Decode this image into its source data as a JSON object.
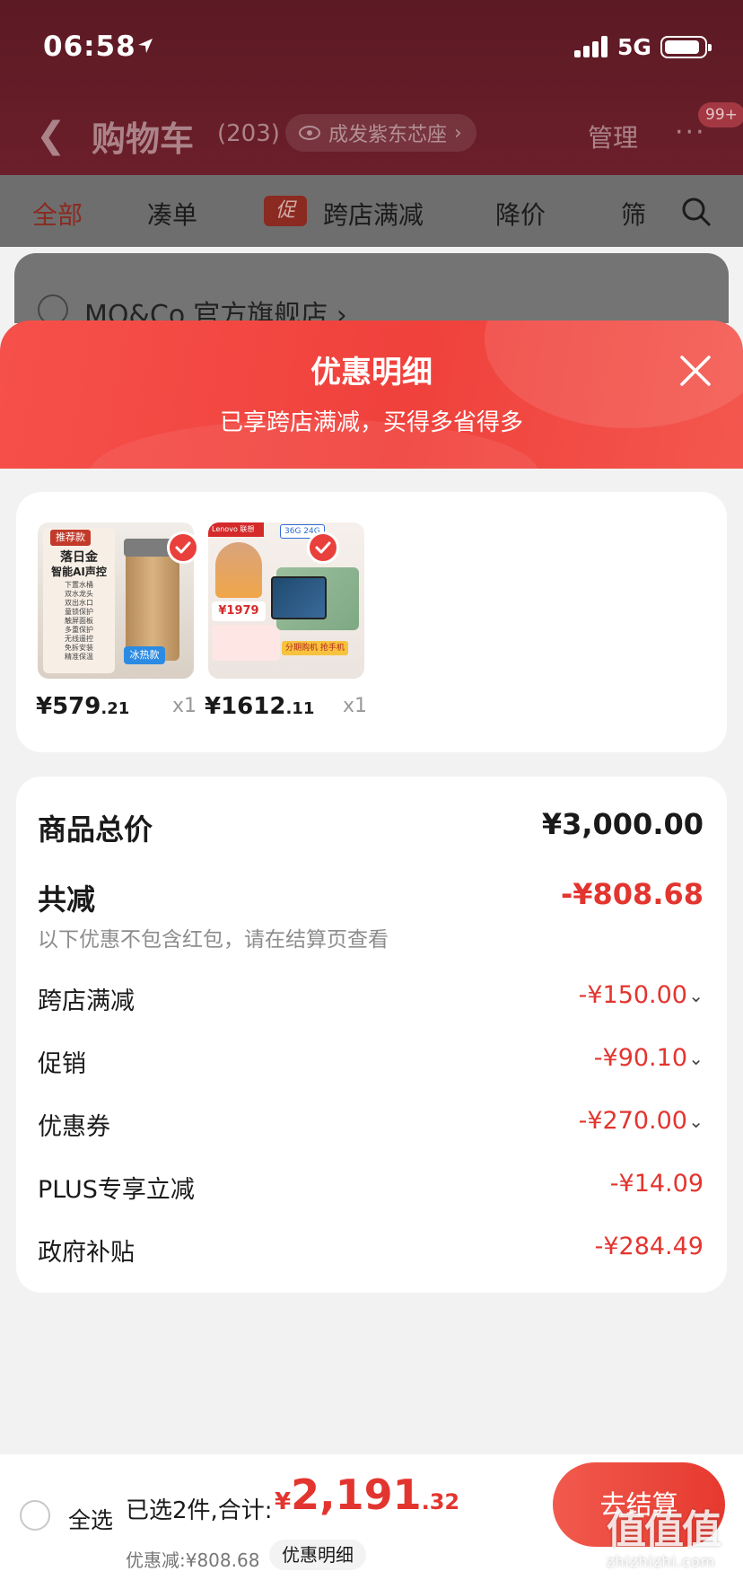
{
  "status_bar": {
    "time": "06:58",
    "network": "5G"
  },
  "nav": {
    "title": "购物车",
    "count": "(203)",
    "address": "成发紫东芯座",
    "manage": "管理",
    "more": "···",
    "badge": "99+"
  },
  "tabs": {
    "all": "全部",
    "bundle": "凑单",
    "promo_tag": "促",
    "cross_store": "跨店满减",
    "price_drop": "降价",
    "filter": "筛"
  },
  "store": {
    "name": "MO&Co.官方旗舰店 ›"
  },
  "sheet": {
    "title": "优惠明细",
    "subtitle": "已享跨店满减，买得多省得多"
  },
  "products": [
    {
      "price_int": "¥579",
      "price_dec": ".21",
      "qty": "x1",
      "thumb_tags": {
        "recommend": "推荐款",
        "name_line1": "落日金",
        "name_line2": "智能AI声控",
        "features": [
          "下置水桶",
          "双水龙头",
          "双出水口",
          "童锁保护",
          "触屏面板",
          "多重保护",
          "无线遥控",
          "免拆安装",
          "精准保温"
        ],
        "variant": "冰热款"
      }
    },
    {
      "price_int": "¥1612",
      "price_dec": ".11",
      "qty": "x1",
      "thumb_tags": {
        "brand": "Lenovo 联想",
        "spec": "36G 24G",
        "price_tag": "¥1979",
        "promo": "分期购机 抢手机"
      }
    }
  ],
  "details": {
    "total_label": "商品总价",
    "total_value": "¥3,000.00",
    "reduce_label": "共减",
    "reduce_value": "-¥808.68",
    "hint": "以下优惠不包含红包，请在结算页查看",
    "items": [
      {
        "label": "跨店满减",
        "value": "-¥150.00",
        "expandable": true
      },
      {
        "label": "促销",
        "value": "-¥90.10",
        "expandable": true
      },
      {
        "label": "优惠券",
        "value": "-¥270.00",
        "expandable": true
      },
      {
        "label": "PLUS专享立减",
        "value": "-¥14.09",
        "expandable": false
      },
      {
        "label": "政府补贴",
        "value": "-¥284.49",
        "expandable": false
      }
    ]
  },
  "bottom": {
    "select_all": "全选",
    "selected": "已选2件,合计:",
    "total_cur": "¥",
    "total_int": "2,191",
    "total_dec": ".32",
    "discount": "优惠减:¥808.68",
    "detail_btn": "优惠明细",
    "checkout": "去结算"
  },
  "watermark": {
    "glyphs": "值值值",
    "url": "zhizhizhi.com"
  },
  "colors": {
    "accent_red": "#e3352f",
    "sheet_header": "#f0413c",
    "page_bg": "#f2f2f2"
  }
}
